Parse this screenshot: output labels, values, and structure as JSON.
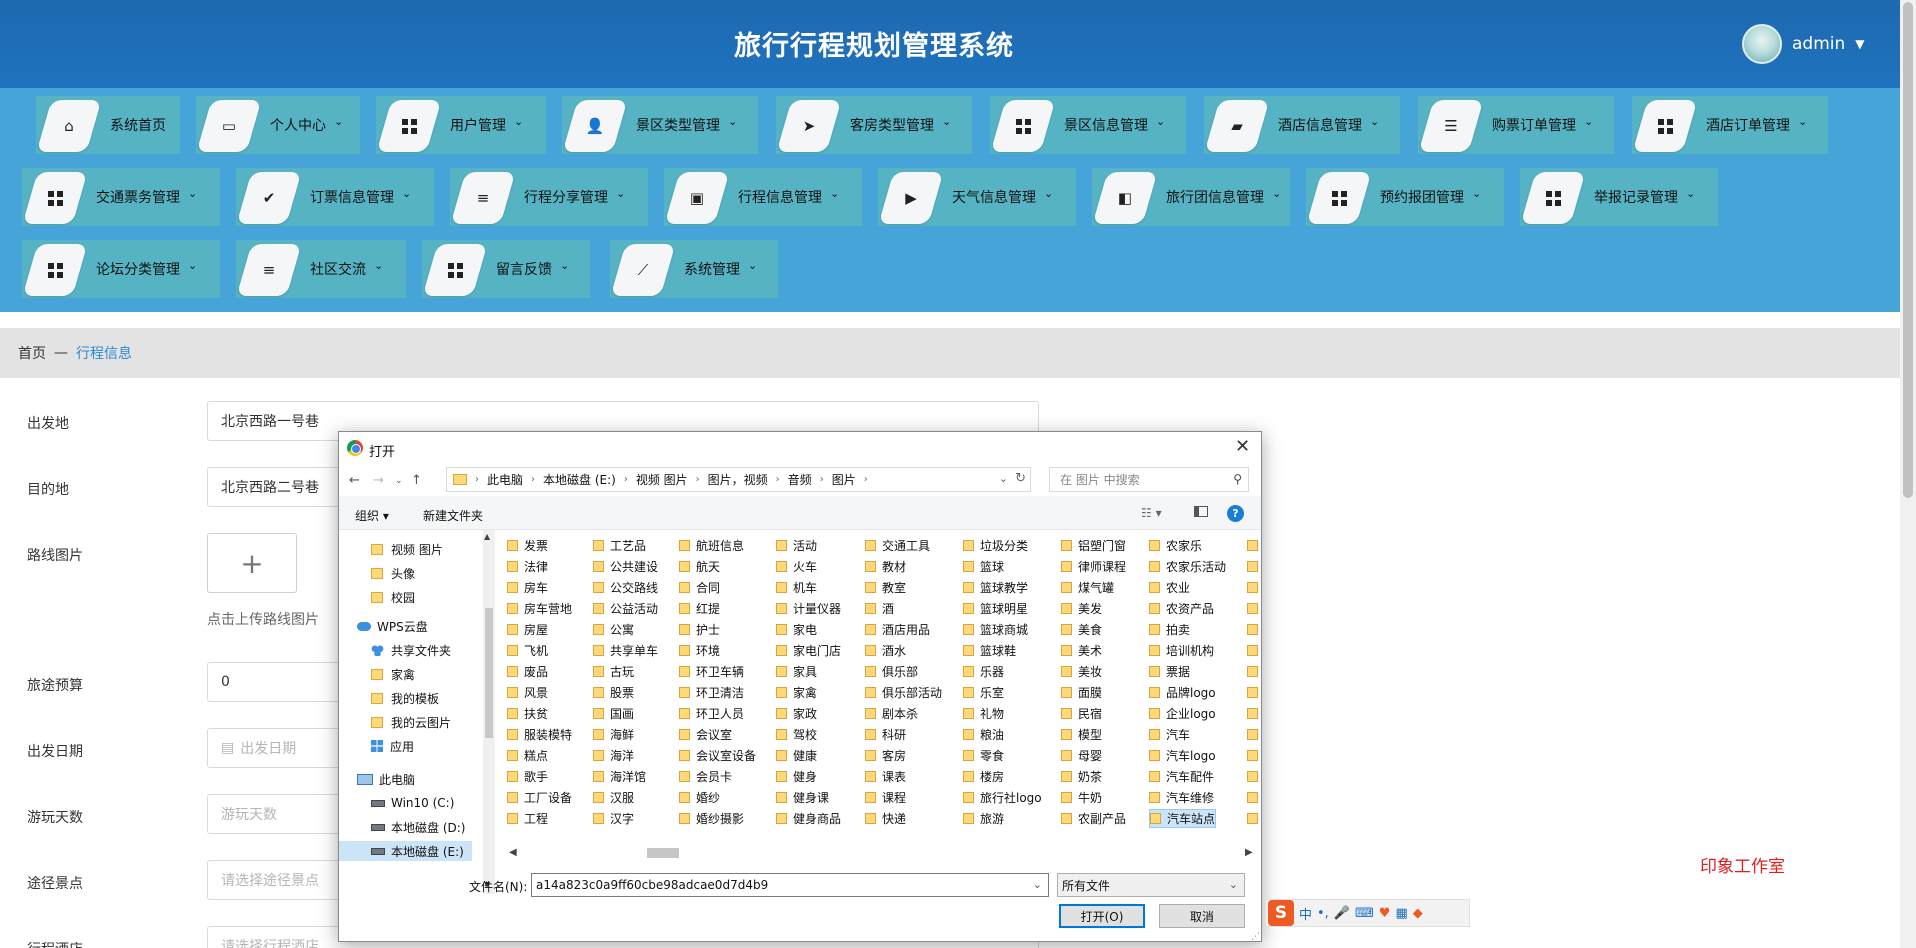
{
  "header": {
    "title": "旅行行程规划管理系统",
    "username": "admin"
  },
  "nav": {
    "row1": [
      "系统首页",
      "个人中心",
      "用户管理",
      "景区类型管理",
      "客房类型管理",
      "景区信息管理",
      "酒店信息管理",
      "购票订单管理",
      "酒店订单管理"
    ],
    "row2": [
      "交通票务管理",
      "订票信息管理",
      "行程分享管理",
      "行程信息管理",
      "天气信息管理",
      "旅行团信息管理",
      "预约报团管理",
      "举报记录管理"
    ],
    "row3": [
      "论坛分类管理",
      "社区交流",
      "留言反馈",
      "系统管理"
    ]
  },
  "breadcrumb": {
    "home": "首页",
    "separator": "—",
    "current": "行程信息"
  },
  "form": {
    "departure": {
      "label": "出发地",
      "value": "北京西路一号巷"
    },
    "destination": {
      "label": "目的地",
      "value": "北京西路二号巷"
    },
    "route_image": {
      "label": "路线图片",
      "tip": "点击上传路线图片"
    },
    "budget": {
      "label": "旅途预算",
      "value": "0"
    },
    "date": {
      "label": "出发日期",
      "placeholder": "出发日期"
    },
    "days": {
      "label": "游玩天数",
      "placeholder": "游玩天数"
    },
    "spots": {
      "label": "途径景点",
      "placeholder": "请选择途径景点"
    },
    "hotel": {
      "label": "行程酒店",
      "placeholder": "请选择行程酒店"
    }
  },
  "watermark": "印象工作室",
  "dialog": {
    "title": "打开",
    "path": [
      "此电脑",
      "本地磁盘 (E:)",
      "视频 图片",
      "图片，视频",
      "音频",
      "图片"
    ],
    "search_placeholder": "在 图片 中搜索",
    "organize": "组织 ▾",
    "new_folder": "新建文件夹",
    "tree": [
      "视频 图片",
      "头像",
      "校园",
      "WPS云盘",
      "共享文件夹",
      "家禽",
      "我的模板",
      "我的云图片",
      "应用",
      "此电脑",
      "Win10 (C:)",
      "本地磁盘 (D:)",
      "本地磁盘 (E:)"
    ],
    "columns": [
      [
        "发票",
        "法律",
        "房车",
        "房车营地",
        "房屋",
        "飞机",
        "废品",
        "风景",
        "扶贫",
        "服装模特",
        "糕点",
        "歌手",
        "工厂设备",
        "工程"
      ],
      [
        "工艺品",
        "公共建设",
        "公交路线",
        "公益活动",
        "公寓",
        "共享单车",
        "古玩",
        "股票",
        "国画",
        "海鲜",
        "海洋",
        "海洋馆",
        "汉服",
        "汉字"
      ],
      [
        "航班信息",
        "航天",
        "合同",
        "红提",
        "护士",
        "环境",
        "环卫车辆",
        "环卫清洁",
        "环卫人员",
        "会议室",
        "会议室设备",
        "会员卡",
        "婚纱",
        "婚纱摄影"
      ],
      [
        "活动",
        "火车",
        "机车",
        "计量仪器",
        "家电",
        "家电门店",
        "家具",
        "家禽",
        "家政",
        "驾校",
        "健康",
        "健身",
        "健身课",
        "健身商品"
      ],
      [
        "交通工具",
        "教材",
        "教室",
        "酒",
        "酒店用品",
        "酒水",
        "俱乐部",
        "俱乐部活动",
        "剧本杀",
        "科研",
        "客房",
        "课表",
        "课程",
        "快递"
      ],
      [
        "垃圾分类",
        "篮球",
        "篮球教学",
        "篮球明星",
        "篮球商城",
        "篮球鞋",
        "乐器",
        "乐室",
        "礼物",
        "粮油",
        "零食",
        "楼房",
        "旅行社logo",
        "旅游"
      ],
      [
        "铝塑门窗",
        "律师课程",
        "煤气罐",
        "美发",
        "美食",
        "美术",
        "美妆",
        "面膜",
        "民宿",
        "模型",
        "母婴",
        "奶茶",
        "牛奶",
        "农副产品"
      ],
      [
        "农家乐",
        "农家乐活动",
        "农业",
        "农资产品",
        "拍卖",
        "培训机构",
        "票据",
        "品牌logo",
        "企业logo",
        "汽车",
        "汽车logo",
        "汽车配件",
        "汽车维修",
        "汽车站点"
      ]
    ],
    "selected_file": "汽车站点",
    "filename_label": "文件名(N):",
    "filename_value": "a14a823c0a9ff60cbe98adcae0d7d4b9",
    "filetype": "所有文件",
    "open_button": "打开(O)",
    "cancel_button": "取消"
  },
  "ime": {
    "logo": "S",
    "mode": "中"
  }
}
